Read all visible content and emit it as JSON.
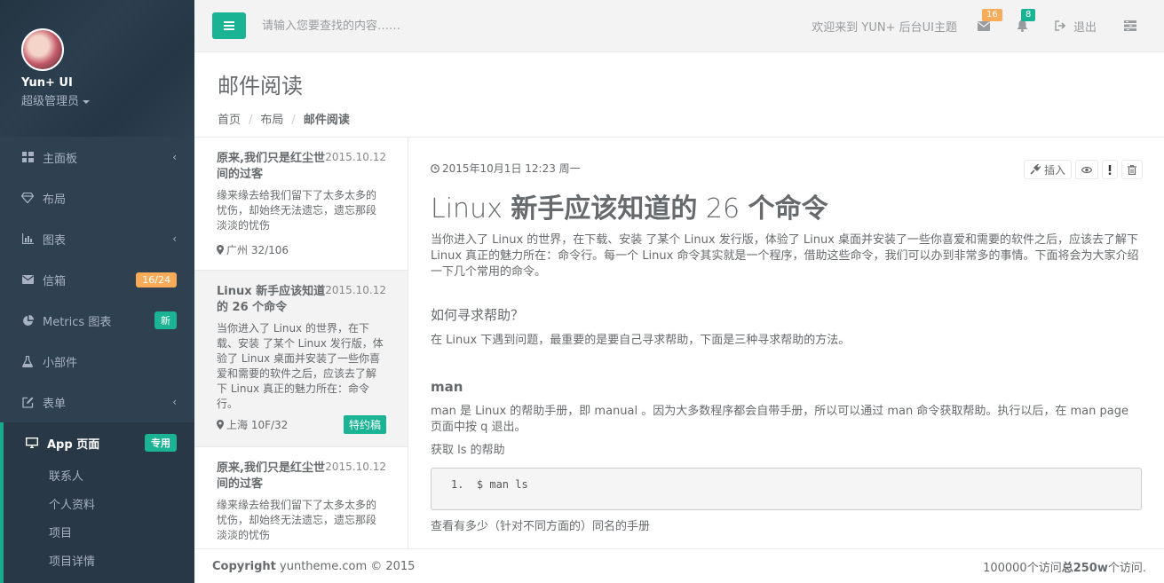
{
  "sidebar": {
    "profile": {
      "name": "Yun+ UI",
      "role": "超级管理员"
    },
    "items": [
      {
        "label": "主面板",
        "icon": "dashboard-icon"
      },
      {
        "label": "布局",
        "icon": "diamond-icon"
      },
      {
        "label": "图表",
        "icon": "bar-chart-icon"
      },
      {
        "label": "信箱",
        "icon": "envelope-icon",
        "badge": "16/24"
      },
      {
        "label": "Metrics 图表",
        "icon": "pie-chart-icon",
        "badge": "新"
      },
      {
        "label": "小部件",
        "icon": "flask-icon"
      },
      {
        "label": "表单",
        "icon": "edit-icon"
      },
      {
        "label": "App 页面",
        "icon": "desktop-icon",
        "badge": "专用"
      }
    ],
    "subitems": [
      "联系人",
      "个人资料",
      "项目",
      "项目详情"
    ]
  },
  "topbar": {
    "search_placeholder": "请输入您要查找的内容……",
    "welcome": "欢迎来到 YUN+ 后台UI主题",
    "mail_count": "16",
    "alert_count": "8",
    "logout": "退出"
  },
  "heading": {
    "title": "邮件阅读",
    "breadcrumb": [
      "首页",
      "布局",
      "邮件阅读"
    ]
  },
  "mails": [
    {
      "title": "原来,我们只是红尘世间的过客",
      "date": "2015.10.12",
      "excerpt": "缘来缘去给我们留下了太多太多的忧伤，却始终无法遗忘，遗忘那段淡淡的忧伤",
      "location": "广州 32/106",
      "tag": ""
    },
    {
      "title": "Linux 新手应该知道的 26 个命令",
      "date": "2015.10.12",
      "excerpt": "当你进入了 Linux 的世界，在下载、安装 了某个 Linux 发行版，体验了 Linux 桌面并安装了一些你喜爱和需要的软件之后，应该去了解下 Linux 真正的魅力所在：命令行。",
      "location": "上海 10F/32",
      "tag": "特约稿"
    },
    {
      "title": "原来,我们只是红尘世间的过客",
      "date": "2015.10.12",
      "excerpt": "缘来缘去给我们留下了太多太多的忧伤，却始终无法遗忘，遗忘那段淡淡的忧伤",
      "location": "",
      "tag": ""
    }
  ],
  "article": {
    "meta": "2015年10月1日 12:23 周一",
    "tools": {
      "insert": "插入"
    },
    "title_light1": "Linux ",
    "title_bold1": "新手应该知道的",
    "title_light2": " 26 ",
    "title_bold2": "个命令",
    "intro": "当你进入了 Linux 的世界，在下载、安装 了某个 Linux 发行版，体验了 Linux 桌面并安装了一些你喜爱和需要的软件之后，应该去了解下 Linux 真正的魅力所在：命令行。每一个 Linux 命令其实就是一个程序，借助这些命令，我们可以办到非常多的事情。下面将会为大家介绍一下几个常用的命令。",
    "h_help": "如何寻求帮助？",
    "p_help": "在 Linux 下遇到问题，最重要的是要自己寻求帮助，下面是三种寻求帮助的方法。",
    "h_man": "man",
    "p_man": "man 是 Linux 的帮助手册，即 manual 。因为大多数程序都会自带手册，所以可以通过 man 命令获取帮助。执行以后，在 man page 页面中按 q 退出。",
    "p_ls": "获取 ls 的帮助",
    "code": "1.  $ man ls",
    "p_count": "查看有多少（针对不同方面的）同名的手册"
  },
  "footer": {
    "copyright_bold": "Copyright",
    "copyright_rest": " yuntheme.com © 2015",
    "visits_pre": "100000个访问",
    "visits_bold": "总250w",
    "visits_post": "个访问."
  },
  "colors": {
    "accent": "#1ab394",
    "warning": "#f8ac59",
    "sidebar": "#2f4050"
  }
}
